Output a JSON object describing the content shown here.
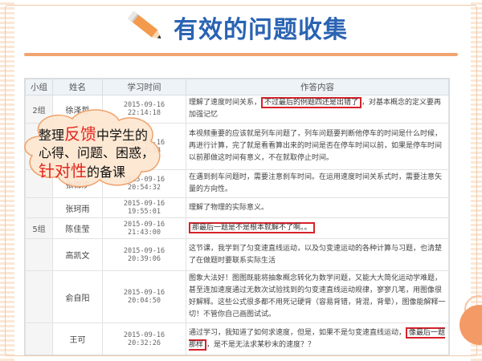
{
  "title": "有效的问题收集",
  "table": {
    "headers": [
      "小组",
      "姓名",
      "学习时间",
      "作答内容"
    ],
    "rows": [
      {
        "group": "2组",
        "name": "徐泽哲",
        "time": "2015-09-16 22:14:18",
        "pre": "理解了速度时间关系，",
        "highlight": "不过最后的例题四还是出错了",
        "post": "，对基本概念的定义要再加强记忆"
      },
      {
        "group": "",
        "name": "",
        "time": "2015-09-16 20:57:38",
        "pre": "本视频重要的应该就是列车问题了，列车问题要判断他停车的时间是什么时候，再进行计算，完了就是看看算出来的时间是否在停车时间以前，如果是停车时间以前那做这时间有意义，不在就取停止时间。",
        "highlight": "",
        "post": ""
      },
      {
        "group": "",
        "name": "张锦汐",
        "time": "2015-09-16 20:54:32",
        "pre": "在遇到刹车问题时，需要注意刹车时间。在运用速度时间关系式时，需要注意矢量的方向性。",
        "highlight": "",
        "post": ""
      },
      {
        "group": "",
        "name": "张珂雨",
        "time": "2015-09-16 19:55:01",
        "pre": "理解了物理的实际意义。",
        "highlight": "",
        "post": ""
      },
      {
        "group": "5组",
        "name": "陈佳莹",
        "time": "2015-09-16 21:43:00",
        "pre": "",
        "highlight": "那最后一题是不是根本就解不了啊。。",
        "post": ""
      },
      {
        "group": "",
        "name": "高凯文",
        "time": "2015-09-16 20:39:06",
        "pre": "这节课，我学到了匀变速直线运动，以及匀变速运动的各种计算与习题，也清楚了在做题时要联系实际生活",
        "highlight": "",
        "post": ""
      },
      {
        "group": "",
        "name": "俞自阳",
        "time": "2015-09-16 20:04:50",
        "pre": "图象大法好！图图既能将抽象概念转化为数学问题，又能大大简化运动学难题，甚至连加速度通过无数次试验找到的匀变速直线运动规律，寥寥几笔，用图像很好解释。这些公式很多都不用死记硬背（容易背错，背混，背晕），图像能解释一切！不管你自己画图试试。",
        "highlight": "",
        "post": ""
      },
      {
        "group": "",
        "name": "王可",
        "time": "2015-09-16 20:32:26",
        "pre": "通过学习，我知道了如何求速度，但是，如果不是匀变速直线运动，",
        "highlight": "像最后一题那样",
        "post": "，是不是无法求某秒末的速度？？"
      }
    ]
  },
  "callout": {
    "line1_prefix": "整理",
    "line1_accent": "反馈",
    "line1_suffix": "中学生的",
    "line2": "心得、问题、困惑，",
    "line3_accent": "针对性",
    "line3_suffix": "的备课"
  },
  "colors": {
    "title": "#2b63b3",
    "accent": "#e2261e",
    "highlight_border": "#d6222a",
    "decor": "#f39a67"
  }
}
